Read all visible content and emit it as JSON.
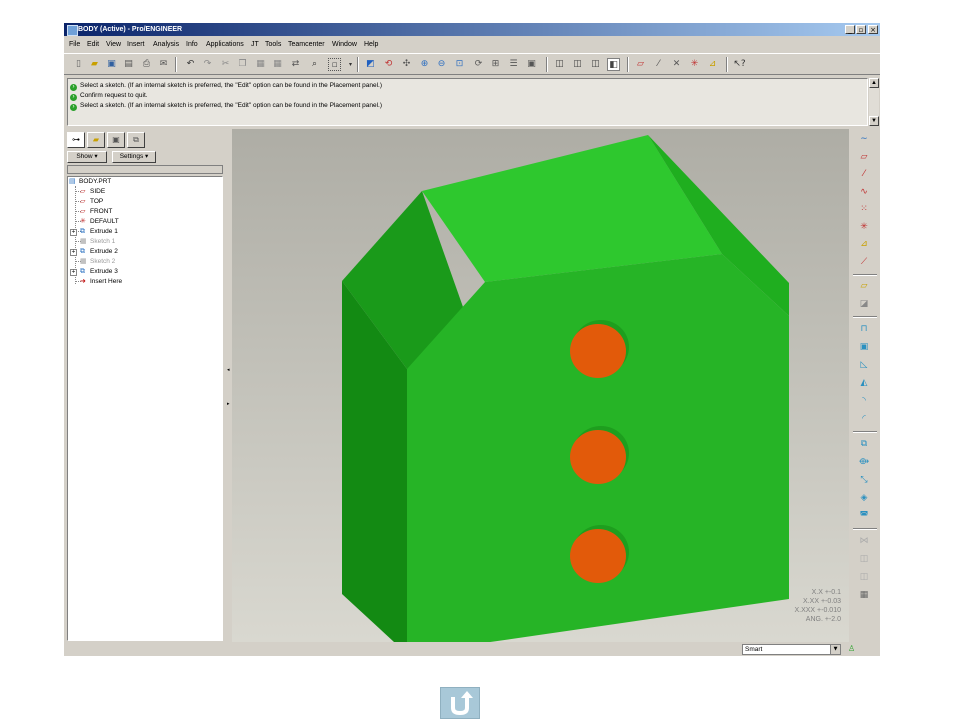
{
  "window": {
    "title": "BODY (Active) - Pro/ENGINEER",
    "controls": [
      "_",
      "▫",
      "×"
    ]
  },
  "menu": [
    "File",
    "Edit",
    "View",
    "Insert",
    "Analysis",
    "Info",
    "Applications",
    "JT",
    "Tools",
    "Teamcenter",
    "Window",
    "Help"
  ],
  "messages": [
    "Select a sketch. (If an internal sketch is preferred, the \"Edit\" option can be found in the Placement panel.)",
    "Confirm request to quit.",
    "Select a sketch. (If an internal sketch is preferred, the \"Edit\" option can be found in the Placement panel.)"
  ],
  "navigator": {
    "show_label": "Show ▾",
    "settings_label": "Settings ▾",
    "tree": [
      {
        "label": "BODY.PRT",
        "icon": "part-icon",
        "dim": false
      },
      {
        "label": "SIDE",
        "icon": "datum-plane-icon",
        "dim": false
      },
      {
        "label": "TOP",
        "icon": "datum-plane-icon",
        "dim": false
      },
      {
        "label": "FRONT",
        "icon": "datum-plane-icon",
        "dim": false
      },
      {
        "label": "DEFAULT",
        "icon": "csys-icon",
        "dim": false
      },
      {
        "label": "Extrude 1",
        "icon": "extrude-icon",
        "dim": false
      },
      {
        "label": "Sketch 1",
        "icon": "sketch-icon",
        "dim": true
      },
      {
        "label": "Extrude 2",
        "icon": "extrude-icon",
        "dim": false
      },
      {
        "label": "Sketch 2",
        "icon": "sketch-icon",
        "dim": true
      },
      {
        "label": "Extrude 3",
        "icon": "extrude-icon",
        "dim": false
      },
      {
        "label": "Insert Here",
        "icon": "insert-arrow-icon",
        "dim": false
      }
    ]
  },
  "tolerances": [
    "X.X +-0.1",
    "X.XX +-0.03",
    "X.XXX +-0.010",
    "ANG. +-2.0"
  ],
  "status": {
    "filter": "Smart"
  },
  "colors": {
    "body": "#22b022",
    "holes": "#e25a0a",
    "title_start": "#0a246a",
    "title_end": "#a6caf0"
  }
}
